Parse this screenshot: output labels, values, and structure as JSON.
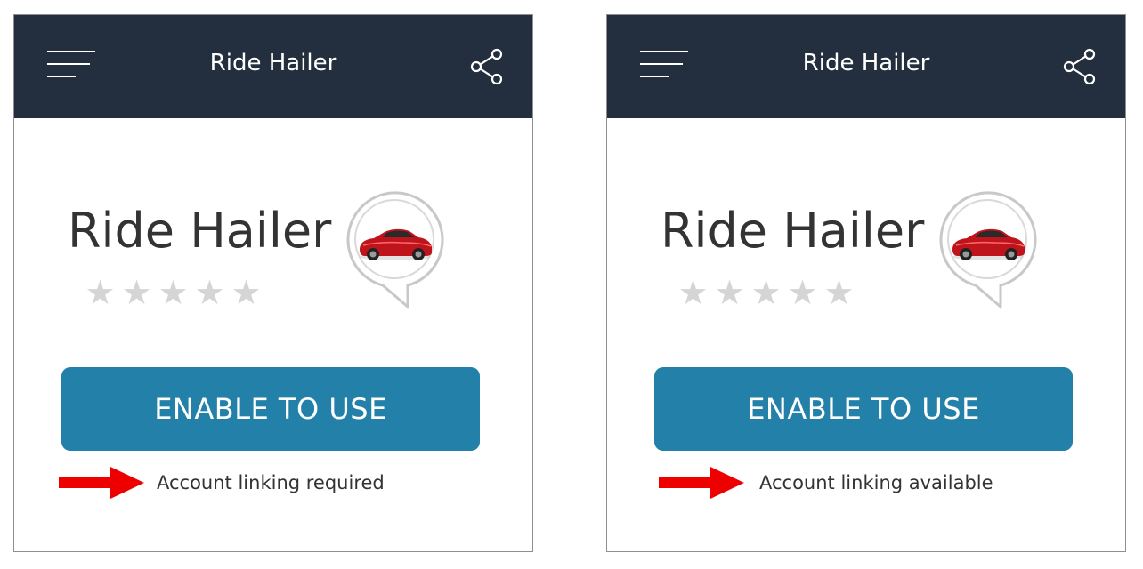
{
  "panels": [
    {
      "header_title": "Ride Hailer",
      "skill_name": "Ride Hailer",
      "rating_stars": 0,
      "rating_max": 5,
      "enable_button_label": "ENABLE TO USE",
      "account_linking_note": "Account linking required"
    },
    {
      "header_title": "Ride Hailer",
      "skill_name": "Ride Hailer",
      "rating_stars": 0,
      "rating_max": 5,
      "enable_button_label": "ENABLE TO USE",
      "account_linking_note": "Account linking available"
    }
  ],
  "icons": {
    "menu": "hamburger-menu-icon",
    "share": "share-icon",
    "skill_logo": "red-sports-car-in-speech-bubble",
    "annotation": "red-arrow-icon",
    "star": "star-icon"
  },
  "colors": {
    "header_bg": "#232f3e",
    "button_bg": "#2280a9",
    "star_empty": "#d5d5d5",
    "arrow": "#ee0000",
    "car": "#c0141c"
  }
}
